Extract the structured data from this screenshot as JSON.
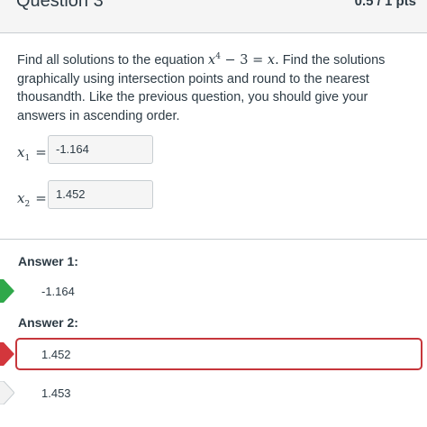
{
  "header": {
    "title": "Question 3",
    "score": "0.5 / 1 pts"
  },
  "question": {
    "intro": "Find all solutions to the equation",
    "equation_base": "x",
    "equation_exp": "4",
    "equation_rest": " − 3 = ",
    "equation_rhs": "x",
    "equation_end": ".",
    "body": "Find the solutions graphically using intersection points and round to the nearest thousandth.  Like the previous question, you should give your answers in ascending order."
  },
  "inputs": [
    {
      "var": "x",
      "sub": "1",
      "eq": "=",
      "value": "-1.164"
    },
    {
      "var": "x",
      "sub": "2",
      "eq": "=",
      "value": "1.452"
    }
  ],
  "answers": [
    {
      "label": "Answer 1:",
      "options": [
        {
          "value": "-1.164",
          "status": "correct"
        }
      ]
    },
    {
      "label": "Answer 2:",
      "options": [
        {
          "value": "1.452",
          "status": "incorrect-selected"
        },
        {
          "value": "1.453",
          "status": "correct-answer"
        }
      ]
    }
  ],
  "colors": {
    "correct": "#2fa84a",
    "incorrect": "#d3363c",
    "neutral": "#f2f2f2",
    "text": "#2d3b45"
  }
}
